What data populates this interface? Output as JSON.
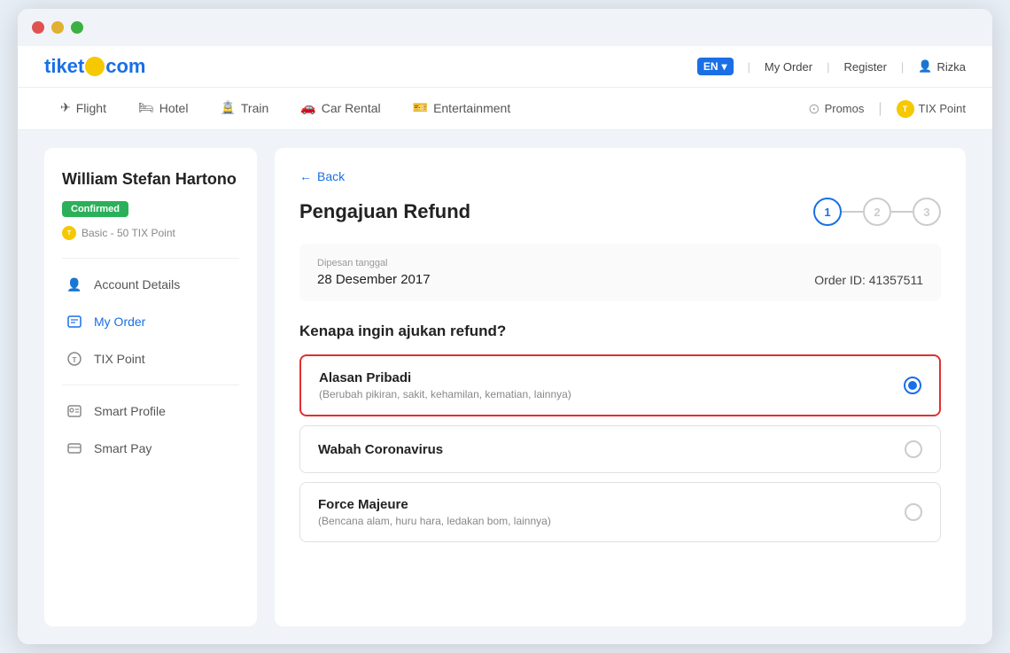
{
  "window": {
    "dots": [
      "red",
      "yellow",
      "green"
    ]
  },
  "header": {
    "logo_tiket": "tiket",
    "logo_com": "com",
    "lang": "EN",
    "my_order": "My Order",
    "register": "Register",
    "user_icon": "👤",
    "username": "Rizka"
  },
  "nav": {
    "items": [
      {
        "label": "Flight",
        "icon": "✈",
        "active": false
      },
      {
        "label": "Hotel",
        "icon": "🛏",
        "active": false
      },
      {
        "label": "Train",
        "icon": "🚊",
        "active": false
      },
      {
        "label": "Car Rental",
        "icon": "🚗",
        "active": false
      },
      {
        "label": "Entertainment",
        "icon": "🎫",
        "active": false
      }
    ],
    "promos": "Promos",
    "tix_point": "TIX Point"
  },
  "sidebar": {
    "user_name": "William Stefan Hartono",
    "confirmed_label": "Confirmed",
    "tix_points_label": "Basic - 50 TIX Point",
    "menu_items": [
      {
        "label": "Account Details",
        "icon": "person",
        "active": false
      },
      {
        "label": "My Order",
        "icon": "order",
        "active": true
      },
      {
        "label": "TIX Point",
        "icon": "tix",
        "active": false
      },
      {
        "label": "Smart Profile",
        "icon": "profile",
        "active": false
      },
      {
        "label": "Smart Pay",
        "icon": "pay",
        "active": false
      }
    ]
  },
  "main": {
    "back_label": "Back",
    "page_title": "Pengajuan Refund",
    "steps": [
      "1",
      "2",
      "3"
    ],
    "order_info": {
      "label": "Dipesan tanggal",
      "date": "28 Desember 2017",
      "order_id_label": "Order ID: 41357511"
    },
    "question": "Kenapa ingin ajukan refund?",
    "options": [
      {
        "title": "Alasan Pribadi",
        "subtitle": "(Berubah pikiran, sakit, kehamilan, kematian, lainnya)",
        "selected": true
      },
      {
        "title": "Wabah Coronavirus",
        "subtitle": "",
        "selected": false
      },
      {
        "title": "Force Majeure",
        "subtitle": "(Bencana alam, huru hara, ledakan bom, lainnya)",
        "selected": false
      }
    ]
  }
}
